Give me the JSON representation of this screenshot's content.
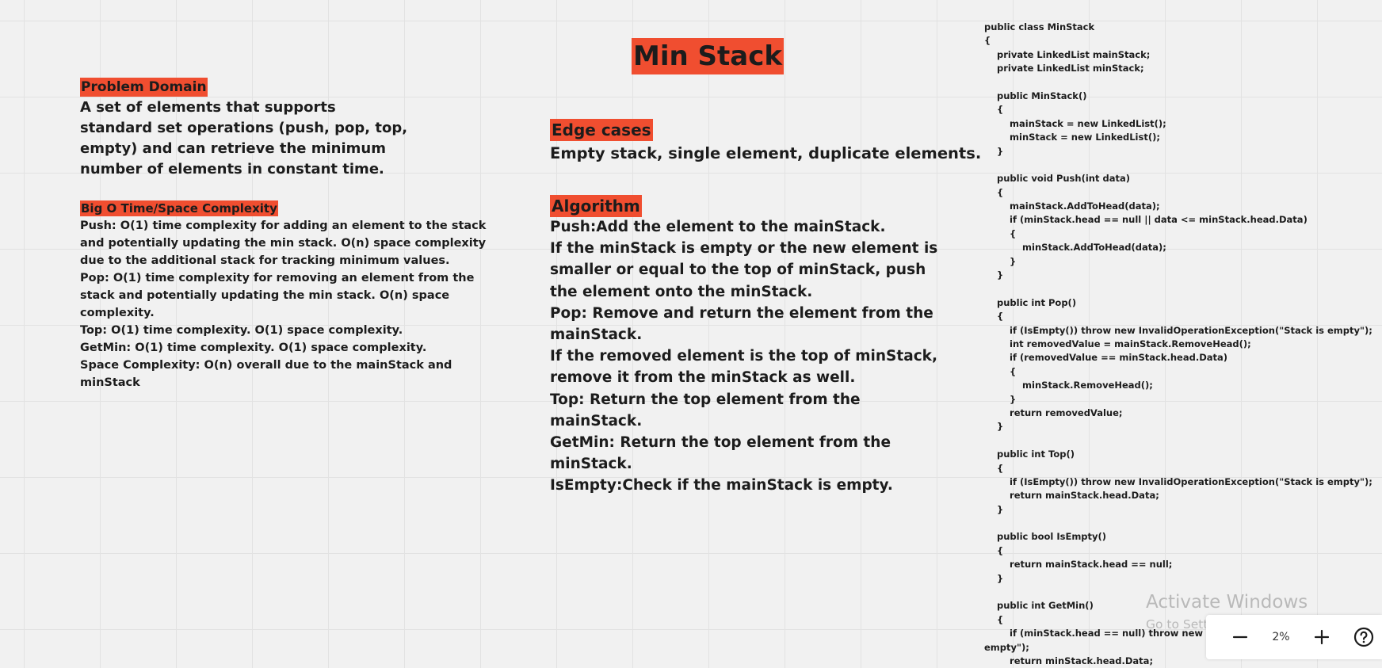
{
  "board": {
    "title": "Min Stack"
  },
  "problem_domain": {
    "heading": "Problem Domain",
    "body": "A set of elements that supports standard set operations (push, pop, top, empty) and can retrieve the minimum number of elements in constant time."
  },
  "big_o": {
    "heading": "Big O Time/Space Complexity",
    "lines": [
      "Push: O(1) time complexity for adding an element to the stack and potentially updating the min stack. O(n) space complexity due to the additional stack for tracking minimum values.",
      "Pop: O(1) time complexity for removing an element from the stack and potentially updating the min stack. O(n) space complexity.",
      "Top: O(1) time complexity. O(1) space complexity.",
      "GetMin: O(1) time complexity. O(1) space complexity.",
      "Space Complexity: O(n) overall due to the mainStack and minStack"
    ]
  },
  "edge_cases": {
    "heading": "Edge cases",
    "body": "Empty stack, single element, duplicate elements."
  },
  "algorithm": {
    "heading": "Algorithm",
    "lines": [
      "Push:Add the element to the mainStack.",
      "If the minStack is empty or the new element is smaller or equal to the top of minStack, push the element onto the minStack.",
      "Pop: Remove and return the element from the mainStack.",
      "If the removed element is the top of minStack, remove it from the minStack as well.",
      "Top: Return the top element from the mainStack.",
      "GetMin: Return the top element from the minStack.",
      "IsEmpty:Check if the mainStack is empty."
    ]
  },
  "code": {
    "lines": [
      "public class MinStack",
      "{",
      "    private LinkedList mainStack;",
      "    private LinkedList minStack;",
      "",
      "    public MinStack()",
      "    {",
      "        mainStack = new LinkedList();",
      "        minStack = new LinkedList();",
      "    }",
      "",
      "    public void Push(int data)",
      "    {",
      "        mainStack.AddToHead(data);",
      "        if (minStack.head == null || data <= minStack.head.Data)",
      "        {",
      "            minStack.AddToHead(data);",
      "        }",
      "    }",
      "",
      "    public int Pop()",
      "    {",
      "        if (IsEmpty()) throw new InvalidOperationException(\"Stack is empty\");",
      "        int removedValue = mainStack.RemoveHead();",
      "        if (removedValue == minStack.head.Data)",
      "        {",
      "            minStack.RemoveHead();",
      "        }",
      "        return removedValue;",
      "    }",
      "",
      "    public int Top()",
      "    {",
      "        if (IsEmpty()) throw new InvalidOperationException(\"Stack is empty\");",
      "        return mainStack.head.Data;",
      "    }",
      "",
      "    public bool IsEmpty()",
      "    {",
      "        return mainStack.head == null;",
      "    }",
      "",
      "    public int GetMin()",
      "    {",
      "        if (minStack.head == null) throw new Inval",
      "empty\");",
      "        return minStack.head.Data;"
    ]
  },
  "watermark": {
    "title": "Activate Windows",
    "subtitle": "Go to Settings to activate Windows."
  },
  "zoom_controls": {
    "zoom_level": "2%",
    "minus_icon": "minus-icon",
    "plus_icon": "plus-icon",
    "help_icon": "help-circle-icon"
  },
  "colors": {
    "highlight": "#f04e30",
    "canvas_background": "#f1f1f1",
    "text": "#1c1c1c"
  }
}
